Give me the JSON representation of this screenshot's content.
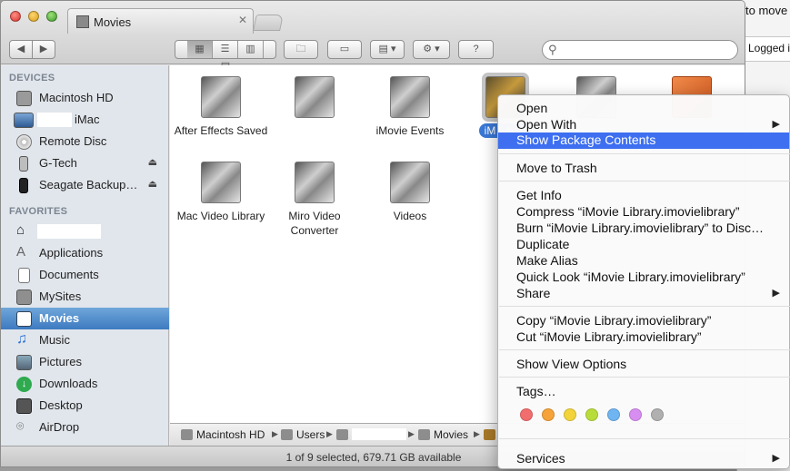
{
  "background_window": {
    "text1": "to move",
    "text2": "Logged i"
  },
  "window": {
    "tab_title": "Movies",
    "toolbar": {
      "back": "◀",
      "forward": "▶"
    }
  },
  "sidebar": {
    "devices_heading": "DEVICES",
    "devices": [
      {
        "label": "Macintosh HD",
        "icon": "hard-drive-icon",
        "eject": false
      },
      {
        "label": "iMac",
        "icon": "imac-icon",
        "eject": false
      },
      {
        "label": "Remote Disc",
        "icon": "disc-icon",
        "eject": false
      },
      {
        "label": "G-Tech",
        "icon": "drive-icon",
        "eject": true
      },
      {
        "label": "Seagate Backup…",
        "icon": "drive-icon",
        "eject": true
      }
    ],
    "favorites_heading": "FAVORITES",
    "favorites": [
      {
        "label": "",
        "icon": "home-icon"
      },
      {
        "label": "Applications",
        "icon": "applications-icon"
      },
      {
        "label": "Documents",
        "icon": "documents-icon"
      },
      {
        "label": "MySites",
        "icon": "folder-icon"
      },
      {
        "label": "Movies",
        "icon": "movies-icon",
        "selected": true
      },
      {
        "label": "Music",
        "icon": "music-icon"
      },
      {
        "label": "Pictures",
        "icon": "pictures-icon"
      },
      {
        "label": "Downloads",
        "icon": "downloads-icon"
      },
      {
        "label": "Desktop",
        "icon": "desktop-icon"
      },
      {
        "label": "AirDrop",
        "icon": "airdrop-icon"
      }
    ],
    "eject_symbol": "⏏"
  },
  "files": [
    {
      "name": "After Effects Saved"
    },
    {
      "name": ""
    },
    {
      "name": "iMovie Events"
    },
    {
      "name": "iM Librar",
      "selected": true
    },
    {
      "name": ""
    },
    {
      "name": ""
    },
    {
      "name": "Mac Video Library"
    },
    {
      "name": "Miro Video Converter"
    },
    {
      "name": "Videos"
    }
  ],
  "pathbar": {
    "crumbs": [
      "Macintosh HD",
      "Users",
      "",
      "Movies",
      ""
    ],
    "separator": "▶"
  },
  "status": "1 of 9 selected, 679.71 GB available",
  "context_menu": {
    "items": [
      {
        "label": "Open"
      },
      {
        "label": "Open With",
        "submenu": true
      },
      {
        "label": "Show Package Contents",
        "highlighted": true
      },
      {
        "label": "Move to Trash"
      },
      {
        "label": "Get Info"
      },
      {
        "label": "Compress “iMovie Library.imovielibrary”"
      },
      {
        "label": "Burn “iMovie Library.imovielibrary” to Disc…"
      },
      {
        "label": "Duplicate"
      },
      {
        "label": "Make Alias"
      },
      {
        "label": "Quick Look “iMovie Library.imovielibrary”"
      },
      {
        "label": "Share",
        "submenu": true
      },
      {
        "label": "Copy “iMovie Library.imovielibrary”"
      },
      {
        "label": "Cut “iMovie Library.imovielibrary”"
      },
      {
        "label": "Show View Options"
      },
      {
        "label": "Tags…"
      },
      {
        "label": "Services",
        "submenu": true
      }
    ],
    "submenu_arrow": "▶",
    "tag_colors": [
      "#f26d6d",
      "#f5a33a",
      "#f2d43a",
      "#b8dd3a",
      "#6fb5f2",
      "#d88ef0",
      "#b0b0b0"
    ]
  }
}
